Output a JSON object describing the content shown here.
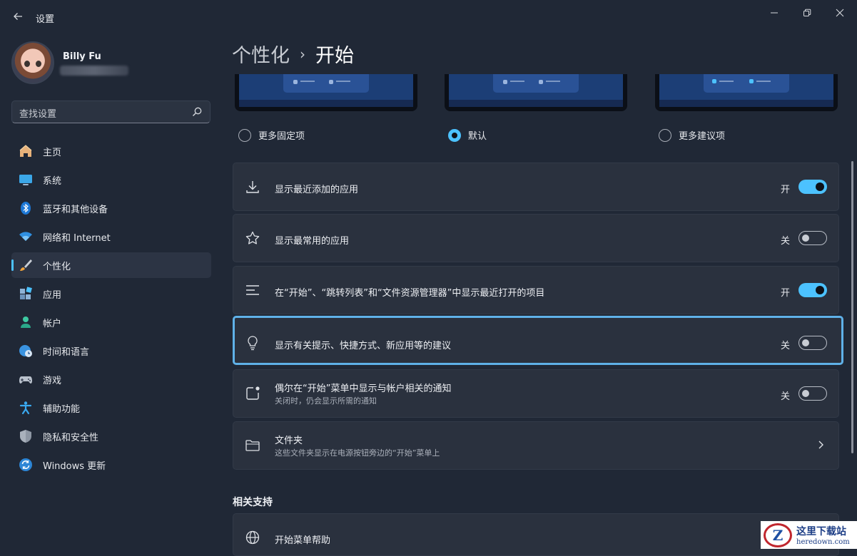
{
  "window": {
    "title": "设置"
  },
  "user": {
    "name": "Billy Fu"
  },
  "search": {
    "placeholder": "查找设置"
  },
  "nav": [
    {
      "label": "主页",
      "icon": "home-icon"
    },
    {
      "label": "系统",
      "icon": "monitor-icon"
    },
    {
      "label": "蓝牙和其他设备",
      "icon": "bluetooth-icon"
    },
    {
      "label": "网络和 Internet",
      "icon": "wifi-icon"
    },
    {
      "label": "个性化",
      "icon": "brush-icon",
      "active": true
    },
    {
      "label": "应用",
      "icon": "apps-icon"
    },
    {
      "label": "帐户",
      "icon": "person-icon"
    },
    {
      "label": "时间和语言",
      "icon": "globe-clock-icon"
    },
    {
      "label": "游戏",
      "icon": "gamepad-icon"
    },
    {
      "label": "辅助功能",
      "icon": "accessibility-icon"
    },
    {
      "label": "隐私和安全性",
      "icon": "shield-icon"
    },
    {
      "label": "Windows 更新",
      "icon": "update-icon"
    }
  ],
  "breadcrumb": {
    "parent": "个性化",
    "separator": "›",
    "current": "开始"
  },
  "layout_options": [
    {
      "label": "更多固定项",
      "selected": false
    },
    {
      "label": "默认",
      "selected": true
    },
    {
      "label": "更多建议项",
      "selected": false
    }
  ],
  "settings": [
    {
      "title": "显示最近添加的应用",
      "state": "开",
      "on": true,
      "icon": "download-icon"
    },
    {
      "title": "显示最常用的应用",
      "state": "关",
      "on": false,
      "icon": "star-icon"
    },
    {
      "title": "在“开始”、“跳转列表”和“文件资源管理器”中显示最近打开的项目",
      "state": "开",
      "on": true,
      "icon": "list-icon"
    },
    {
      "title": "显示有关提示、快捷方式、新应用等的建议",
      "state": "关",
      "on": false,
      "icon": "lightbulb-icon"
    },
    {
      "title": "偶尔在“开始”菜单中显示与帐户相关的通知",
      "subtitle": "关闭时，仍会显示所需的通知",
      "state": "关",
      "on": false,
      "icon": "notification-icon"
    },
    {
      "title": "文件夹",
      "subtitle": "这些文件夹显示在电源按钮旁边的“开始”菜单上",
      "icon": "folder-icon"
    }
  ],
  "related": {
    "heading": "相关支持",
    "help_title": "开始菜单帮助"
  },
  "watermark": {
    "cn": "这里下载站",
    "en": "heredown.com",
    "logo_letter": "Z"
  },
  "colors": {
    "accent": "#4cc2ff",
    "background": "#202836",
    "card": "#2a313e",
    "focus_border": "#5fb1e8"
  }
}
